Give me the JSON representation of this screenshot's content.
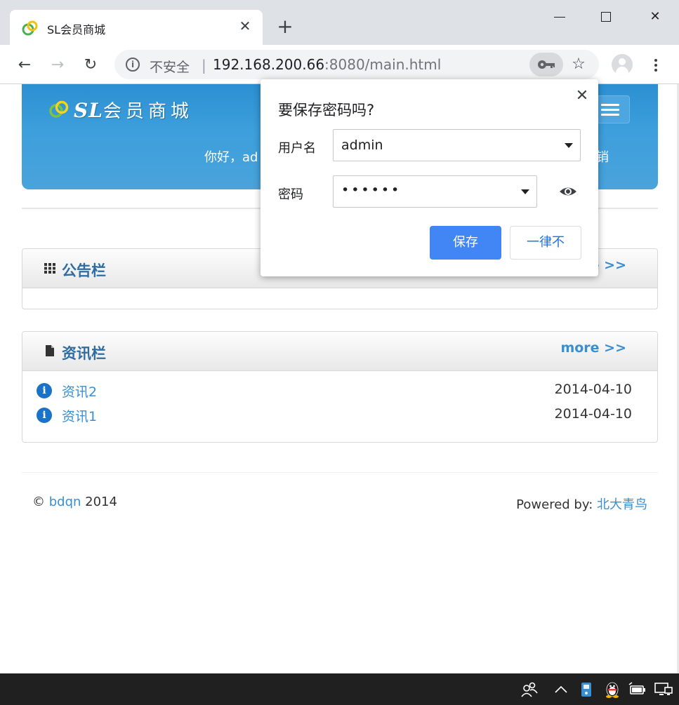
{
  "browser": {
    "tab_title": "SL会员商城",
    "tab_close": "✕",
    "new_tab": "+",
    "security_label": "不安全",
    "separator": "|",
    "url_host": "192.168.200.66",
    "url_rest": ":8080/main.html",
    "icons": {
      "back": "←",
      "forward": "→",
      "reload": "↻",
      "info": "i",
      "star": "☆",
      "close": "✕"
    }
  },
  "header": {
    "logo_latin": "SL",
    "logo_cn": "会员商城",
    "greeting": "你好，ad",
    "logout_fragment": "销"
  },
  "notice_panel": {
    "title": "公告栏",
    "more": "e >>"
  },
  "news_panel": {
    "title": "资讯栏",
    "more": "more >>",
    "items": [
      {
        "title": "资讯2",
        "date": "2014-04-10",
        "icon": "i"
      },
      {
        "title": "资讯1",
        "date": "2014-04-10",
        "icon": "i"
      }
    ]
  },
  "footer": {
    "copyright_symbol": "©",
    "org": "bdqn",
    "year": "2014",
    "powered_label": "Powered by:",
    "powered_link": "北大青鸟"
  },
  "save_password_dialog": {
    "title": "要保存密码吗?",
    "username_label": "用户名",
    "username_value": "admin",
    "password_label": "密码",
    "password_value": "••••••",
    "save_button": "保存",
    "never_button": "一律不",
    "close": "✕"
  },
  "colors": {
    "header_blue": "#3d9fdc",
    "link_blue": "#3a8fd2",
    "primary_button": "#4285f4",
    "taskbar": "#202020"
  }
}
